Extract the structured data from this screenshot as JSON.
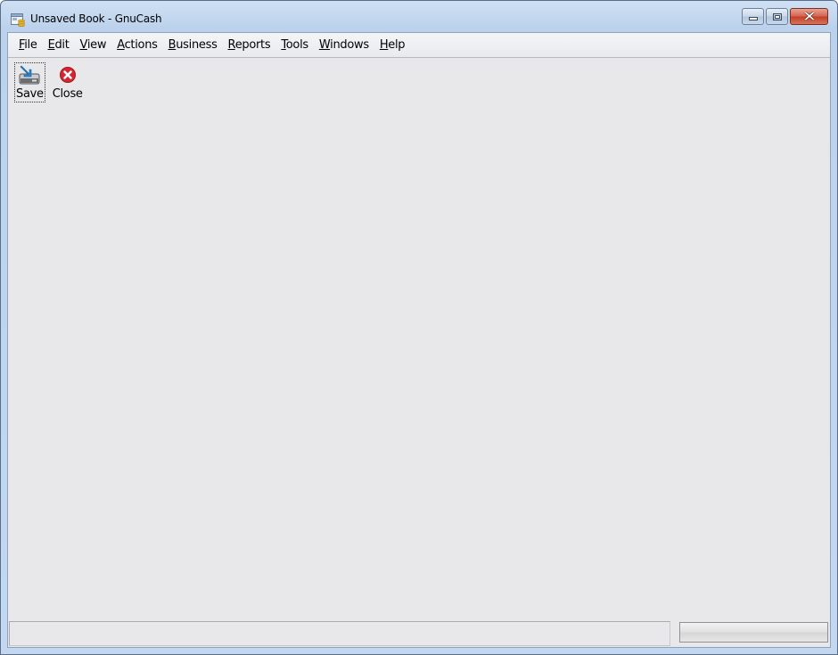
{
  "window": {
    "title": "Unsaved Book - GnuCash",
    "app_icon": "gnucash-icon",
    "controls": {
      "minimize": "minimize-icon",
      "maximize": "maximize-icon",
      "close": "close-icon"
    }
  },
  "menubar": {
    "items": [
      {
        "label": "File",
        "accel": "F"
      },
      {
        "label": "Edit",
        "accel": "E"
      },
      {
        "label": "View",
        "accel": "V"
      },
      {
        "label": "Actions",
        "accel": "A"
      },
      {
        "label": "Business",
        "accel": "B"
      },
      {
        "label": "Reports",
        "accel": "R"
      },
      {
        "label": "Tools",
        "accel": "T"
      },
      {
        "label": "Windows",
        "accel": "W"
      },
      {
        "label": "Help",
        "accel": "H"
      }
    ]
  },
  "toolbar": {
    "save": {
      "label": "Save",
      "icon": "save-icon"
    },
    "close": {
      "label": "Close",
      "icon": "close-circle-icon"
    }
  },
  "statusbar": {
    "text": "",
    "progress": 0
  },
  "colors": {
    "close_accent": "#d9232e",
    "save_accent": "#2a8bd8"
  }
}
